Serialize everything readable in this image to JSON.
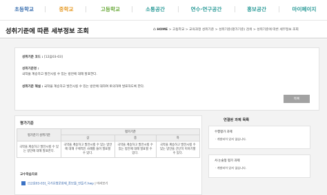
{
  "nav": {
    "items": [
      {
        "label": "초등학교",
        "color": "#3a6fb0"
      },
      {
        "label": "중학교",
        "color": "#e69a25"
      },
      {
        "label": "고등학교",
        "color": "#6aa93a"
      },
      {
        "label": "소통공간",
        "color": "#2f9d9a"
      },
      {
        "label": "연수·연구공간",
        "color": "#2f9d9a"
      },
      {
        "label": "홍보공간",
        "color": "#2f9d9a"
      },
      {
        "label": "마이페이지",
        "color": "#2f9d9a"
      }
    ]
  },
  "page": {
    "title": "성취기준에 따른 세부정보 조회",
    "breadcrumb": {
      "home": "HOME",
      "path": "> 고등학교 > 교육과정 성취기준 > 성취기준(평가기준) 검색 > 성취기준에 따른 세부정보 조회"
    }
  },
  "detail": {
    "code_label": "성취기준 코드 :",
    "code_value": "[12음03-03]",
    "statement_label": "성취기준명 :",
    "statement_value": "국악을 계승하고 발전시킬 수 있는 방안에 대해 발표한다.",
    "explanation_label": "성취기준 해설 :",
    "explanation_value": "국악을 계승하고 발전시킬 수 있는 방안에 대하여 토의하여 발표하도록 한다.",
    "list_button": "목록"
  },
  "evaluation": {
    "title": "평가기준",
    "header_standard": "평가준기 성취기준",
    "header_group": "평가기준",
    "levels": [
      "상",
      "중",
      "하"
    ],
    "rows": [
      {
        "standard": "국악을 계승하고 발전시킬 수 있는 방안에 대해 발표한다.",
        "high": "국악을 계승하고 발전시킬 수 있는 방안에 대해 구체적인 사례를 들어 발표할 수 있다.",
        "mid": "국악을 계승하고 발전시킬 수 있는 방안에 대해 발표할 수 있다.",
        "low": "국악을 계승하고 발전시킬 수 있는 방안을 간단히 이야기할 수 있다."
      }
    ],
    "attachment_title": "교수학습자료",
    "attachment_file": "[12음03-03]_국가유형문화재_종보를_만들기.hwp",
    "attachment_preview": "| 미리보기"
  },
  "sidebar": {
    "title": "연결된 과제 목록",
    "boxes": [
      {
        "title": "수행평가 과제",
        "empty": "개발되어 있지 않습니다."
      },
      {
        "title": "서·논술형 평가 과제",
        "empty": "개발되어 있지 않습니다."
      }
    ]
  }
}
